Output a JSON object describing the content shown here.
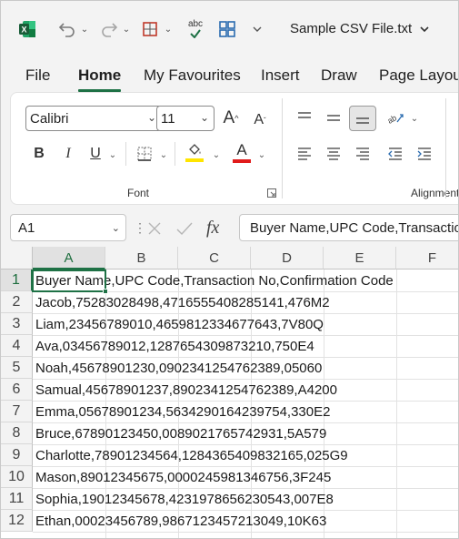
{
  "titlebar": {
    "app_icon": "excel-icon",
    "doc_title": "Sample CSV File.txt",
    "quick_access": [
      "undo-icon",
      "redo-icon",
      "borders-icon",
      "spelling-icon",
      "layout-grid-icon",
      "customize-chevron-icon"
    ]
  },
  "menu": {
    "tabs": [
      "File",
      "Home",
      "My Favourites",
      "Insert",
      "Draw",
      "Page Layout"
    ],
    "active": "Home"
  },
  "ribbon": {
    "font_name": "Calibri",
    "font_size": "11",
    "font_group_label": "Font",
    "alignment_group_label": "Alignment",
    "bold_label": "B",
    "italic_label": "I",
    "underline_label": "U",
    "grow_font_label": "A",
    "shrink_font_label": "A",
    "font_color_label": "A",
    "accent_yellow": "#ffe500",
    "accent_red": "#e11b1b"
  },
  "formula_bar": {
    "name_box": "A1",
    "fx_label": "fx",
    "formula": "Buyer Name,UPC Code,Transaction No,Confirmation Code"
  },
  "grid": {
    "columns": [
      "A",
      "B",
      "C",
      "D",
      "E",
      "F"
    ],
    "active_column": "A",
    "rows": [
      {
        "num": "1",
        "text": "Buyer Name,UPC Code,Transaction No,Confirmation Code"
      },
      {
        "num": "2",
        "text": "Jacob,75283028498,4716555408285141,476M2"
      },
      {
        "num": "3",
        "text": "Liam,23456789010,4659812334677643,7V80Q"
      },
      {
        "num": "4",
        "text": "Ava,03456789012,1287654309873210,750E4"
      },
      {
        "num": "5",
        "text": "Noah,45678901230,0902341254762389,05060"
      },
      {
        "num": "6",
        "text": "Samual,45678901237,8902341254762389,A4200"
      },
      {
        "num": "7",
        "text": "Emma,05678901234,5634290164239754,330E2"
      },
      {
        "num": "8",
        "text": "Bruce,67890123450,0089021765742931,5A579"
      },
      {
        "num": "9",
        "text": "Charlotte,78901234564,1284365409832165,025G9"
      },
      {
        "num": "10",
        "text": "Mason,89012345675,0000245981346756,3F245"
      },
      {
        "num": "11",
        "text": "Sophia,19012345678,4231978656230543,007E8"
      },
      {
        "num": "12",
        "text": "Ethan,00023456789,9867123457213049,10K63"
      }
    ]
  },
  "colors": {
    "excel_green": "#1e7145"
  }
}
